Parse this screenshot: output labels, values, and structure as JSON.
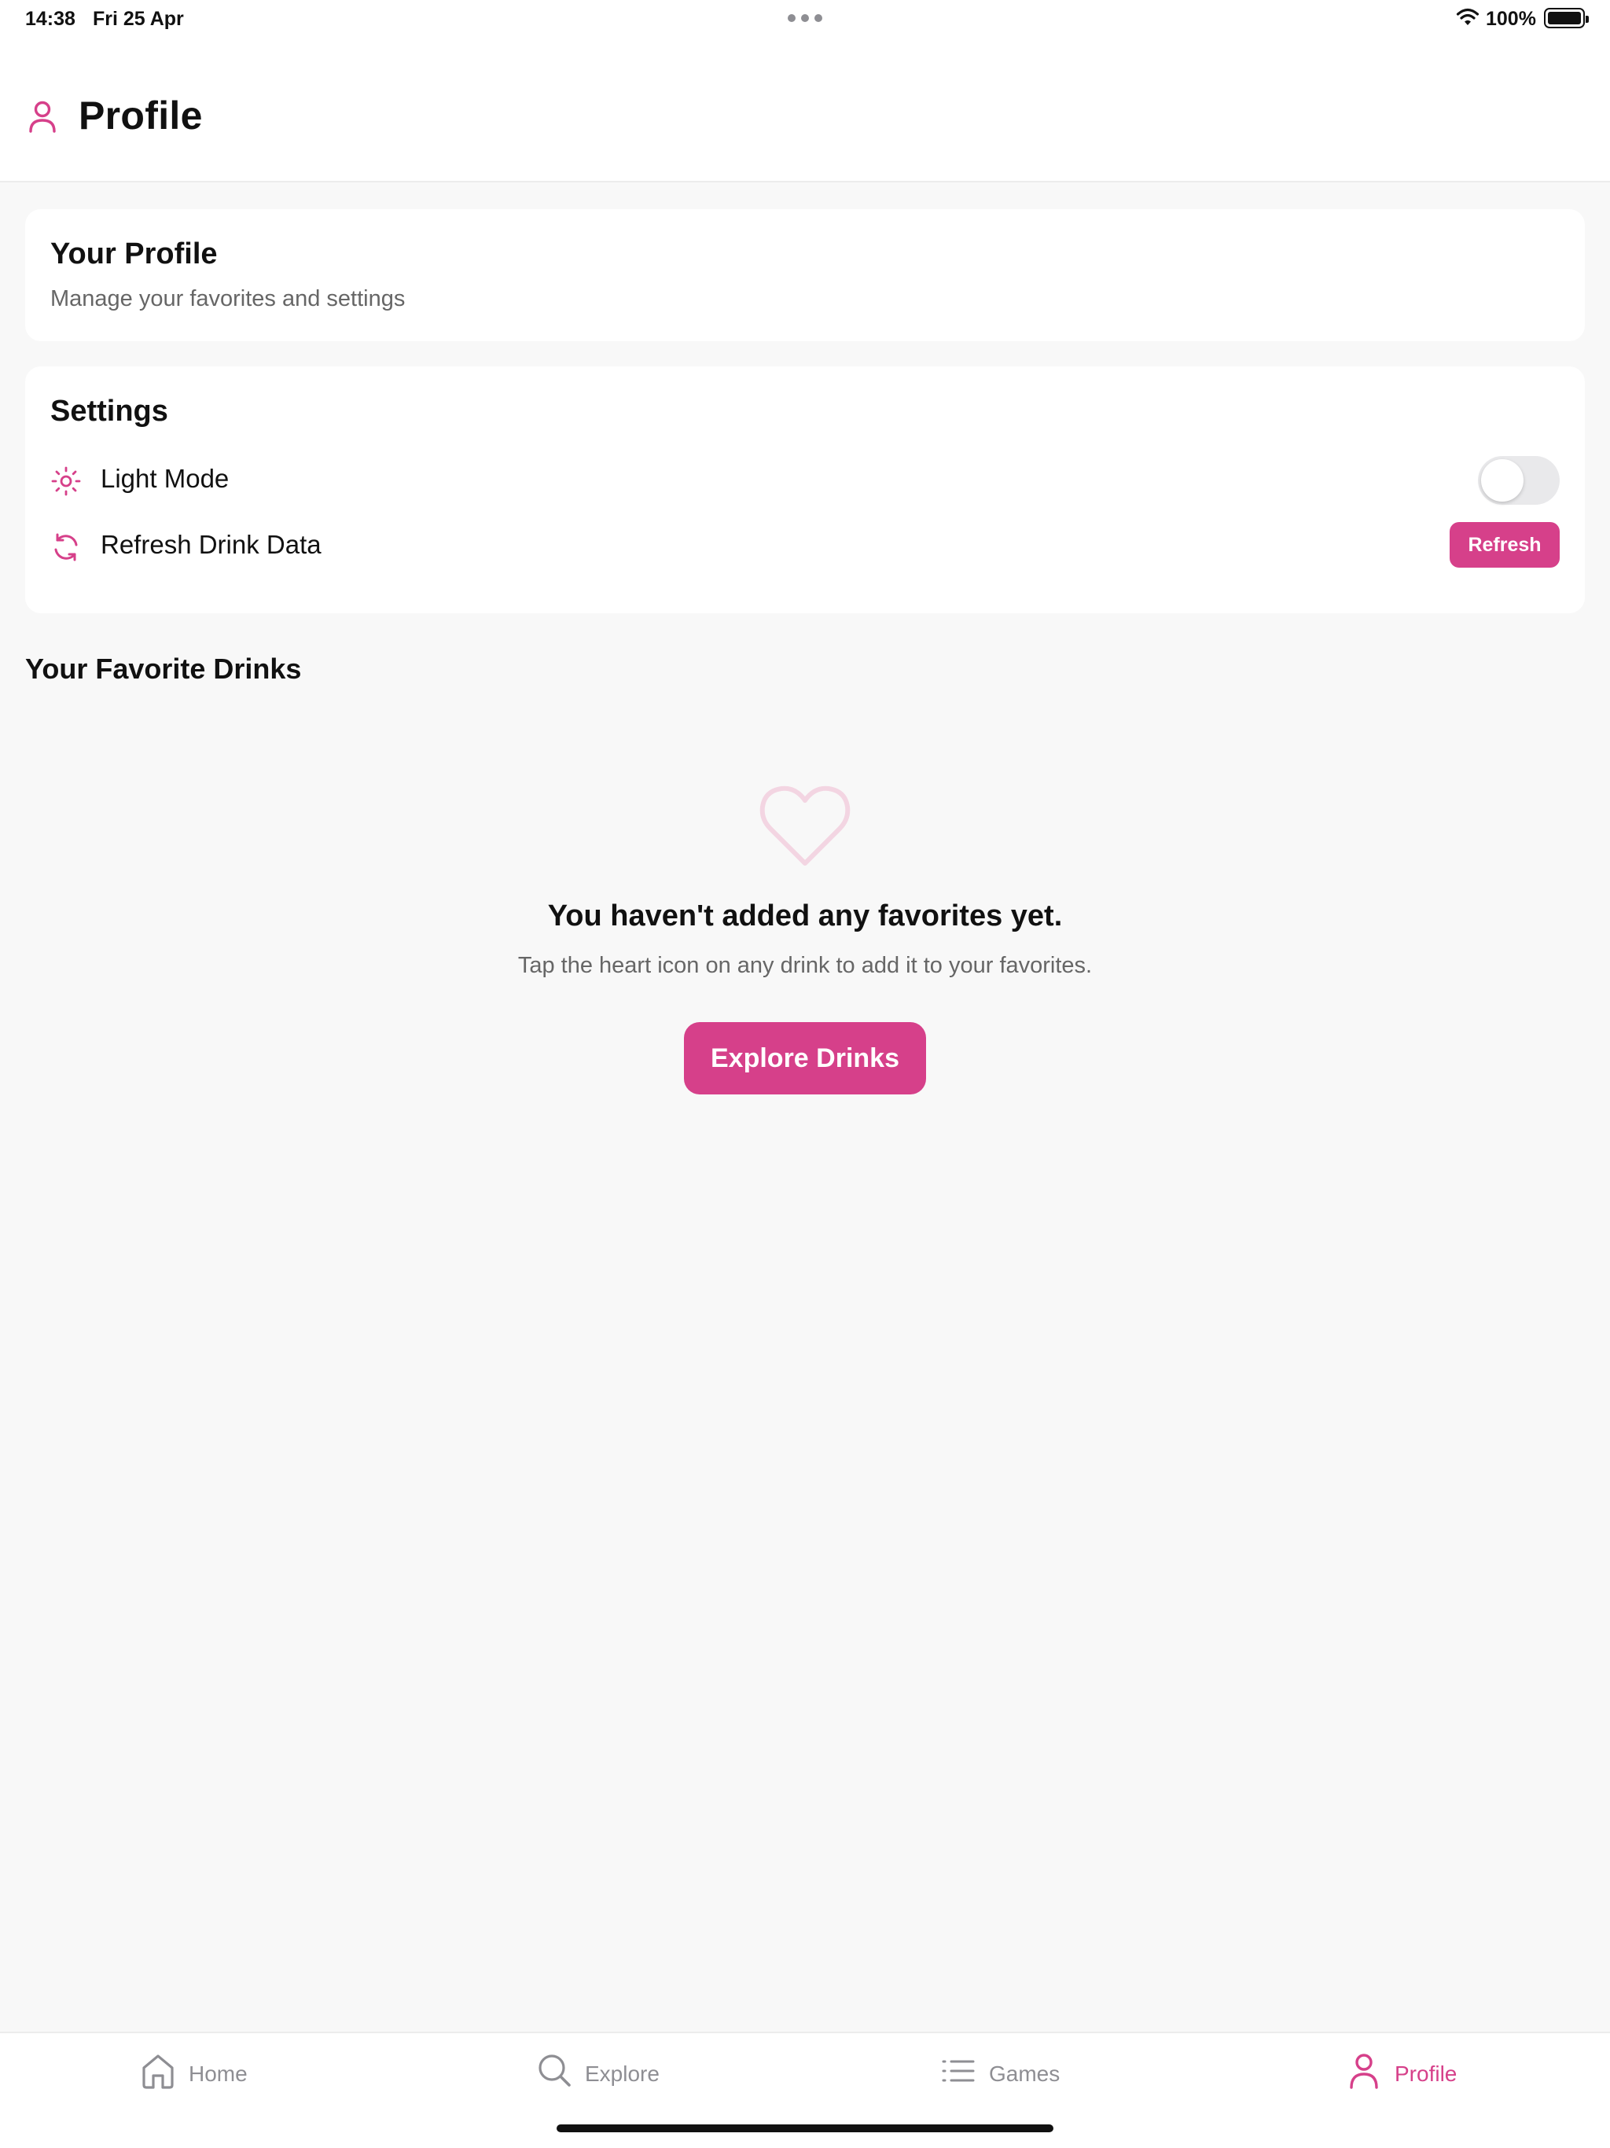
{
  "status_bar": {
    "time": "14:38",
    "date": "Fri 25 Apr",
    "battery": "100%"
  },
  "header": {
    "title": "Profile",
    "icon": "person-icon"
  },
  "profile_card": {
    "title": "Your Profile",
    "subtitle": "Manage your favorites and settings"
  },
  "settings": {
    "title": "Settings",
    "light_mode": {
      "label": "Light Mode",
      "icon": "sun-icon",
      "enabled": false
    },
    "refresh": {
      "label": "Refresh Drink Data",
      "icon": "refresh-icon",
      "button": "Refresh"
    }
  },
  "favorites": {
    "title": "Your Favorite Drinks",
    "empty_title": "You haven't added any favorites yet.",
    "empty_subtitle": "Tap the heart icon on any drink to add it to your favorites.",
    "cta": "Explore Drinks"
  },
  "tabs": [
    {
      "label": "Home",
      "icon": "home-icon",
      "active": false
    },
    {
      "label": "Explore",
      "icon": "search-icon",
      "active": false
    },
    {
      "label": "Games",
      "icon": "list-icon",
      "active": false
    },
    {
      "label": "Profile",
      "icon": "person-icon",
      "active": true
    }
  ],
  "colors": {
    "accent": "#d6408a",
    "background": "#f8f8f8",
    "card": "#ffffff",
    "muted_text": "#666666"
  }
}
